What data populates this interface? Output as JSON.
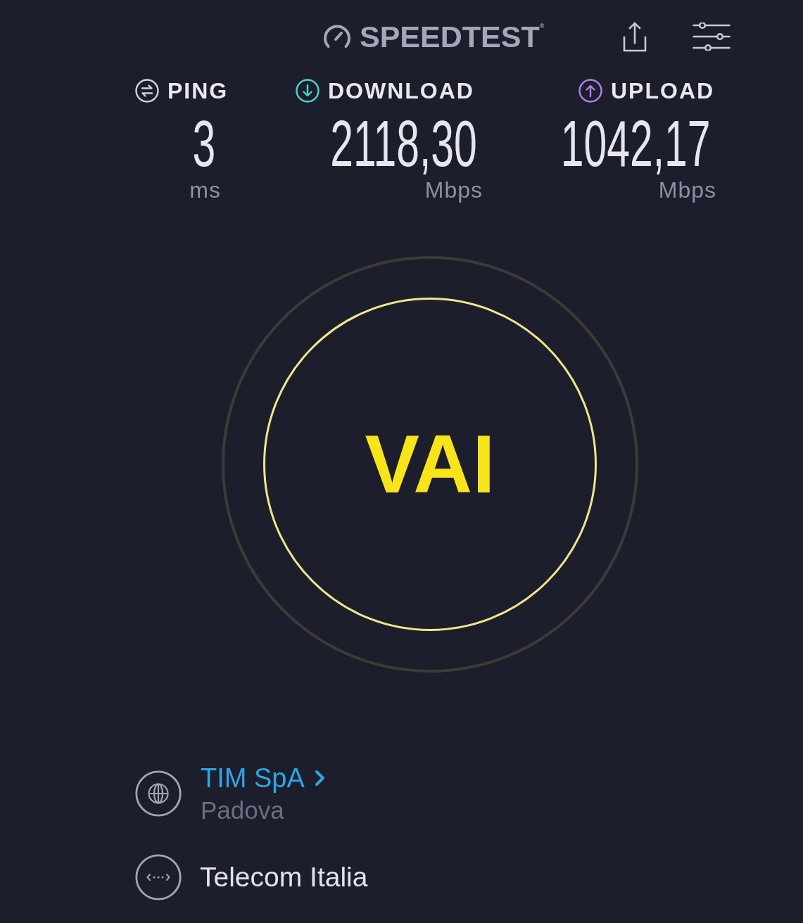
{
  "header": {
    "logo": "SPEEDTEST$^{®}$"
  },
  "metrics": [
    {
      "kind": "ping",
      "label": "PING",
      "value": "3",
      "unit": "ms",
      "color": "#d2d2da"
    },
    {
      "kind": "download",
      "label": "DOWNLOAD",
      "value": "2118,30",
      "unit": "Mbps",
      "color": "#4fd3c9"
    },
    {
      "kind": "upload",
      "label": "UPLOAD",
      "value": "1042,17",
      "unit": "Mbps",
      "color": "#b57cec"
    }
  ],
  "go_button": {
    "label": "VAI"
  },
  "server": {
    "name": "TIM SpA",
    "location": "Padova"
  },
  "provider": {
    "name": "Telecom Italia"
  }
}
